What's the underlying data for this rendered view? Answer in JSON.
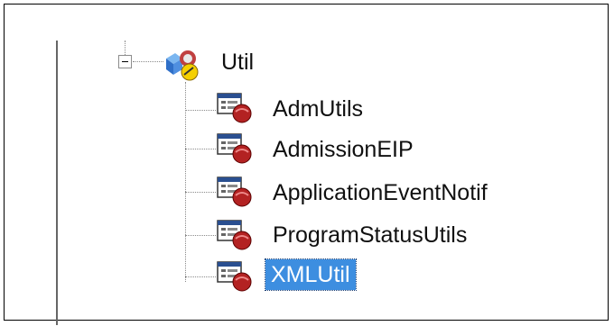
{
  "tree": {
    "root": {
      "label": "Util",
      "icon": "package-icon",
      "expanded": true
    },
    "children": [
      {
        "label": "AdmUtils",
        "icon": "application-icon",
        "selected": false
      },
      {
        "label": "AdmissionEIP",
        "icon": "application-icon",
        "selected": false
      },
      {
        "label": "ApplicationEventNotif",
        "icon": "application-icon",
        "selected": false
      },
      {
        "label": "ProgramStatusUtils",
        "icon": "application-icon",
        "selected": false
      },
      {
        "label": "XMLUtil",
        "icon": "application-icon",
        "selected": true
      }
    ]
  },
  "colors": {
    "selection": "#3d8ee0",
    "text": "#101010"
  }
}
